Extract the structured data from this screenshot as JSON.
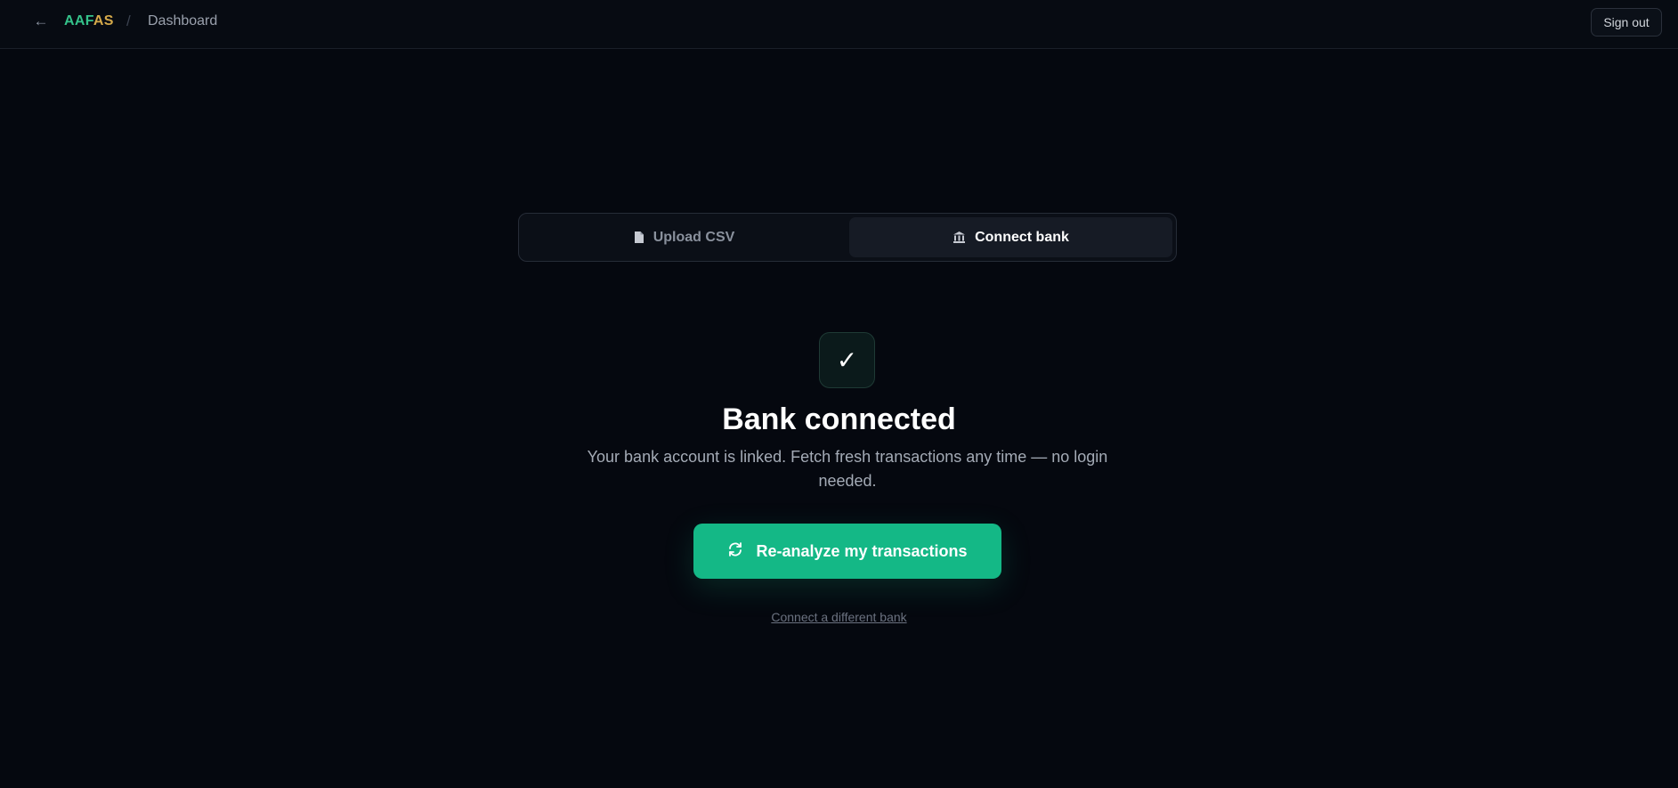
{
  "header": {
    "brand_part1": "AAF",
    "brand_part2": "AS",
    "separator": "/",
    "breadcrumb": "Dashboard",
    "signout_label": "Sign out",
    "back_icon": "arrow-left-icon"
  },
  "tabs": [
    {
      "label": "Upload CSV",
      "icon": "file-icon",
      "active": false
    },
    {
      "label": "Connect bank",
      "icon": "bank-icon",
      "active": true
    }
  ],
  "status": {
    "icon": "check-icon",
    "title": "Bank connected",
    "description": "Your bank account is linked. Fetch fresh transactions any time — no login needed."
  },
  "actions": {
    "primary_label": "Re-analyze my transactions",
    "primary_icon": "refresh-icon",
    "secondary_label": "Connect a different bank"
  },
  "colors": {
    "accent": "#14b886",
    "brand_green": "#34c28a",
    "brand_gold": "#d4a94a",
    "background": "#05080f"
  }
}
